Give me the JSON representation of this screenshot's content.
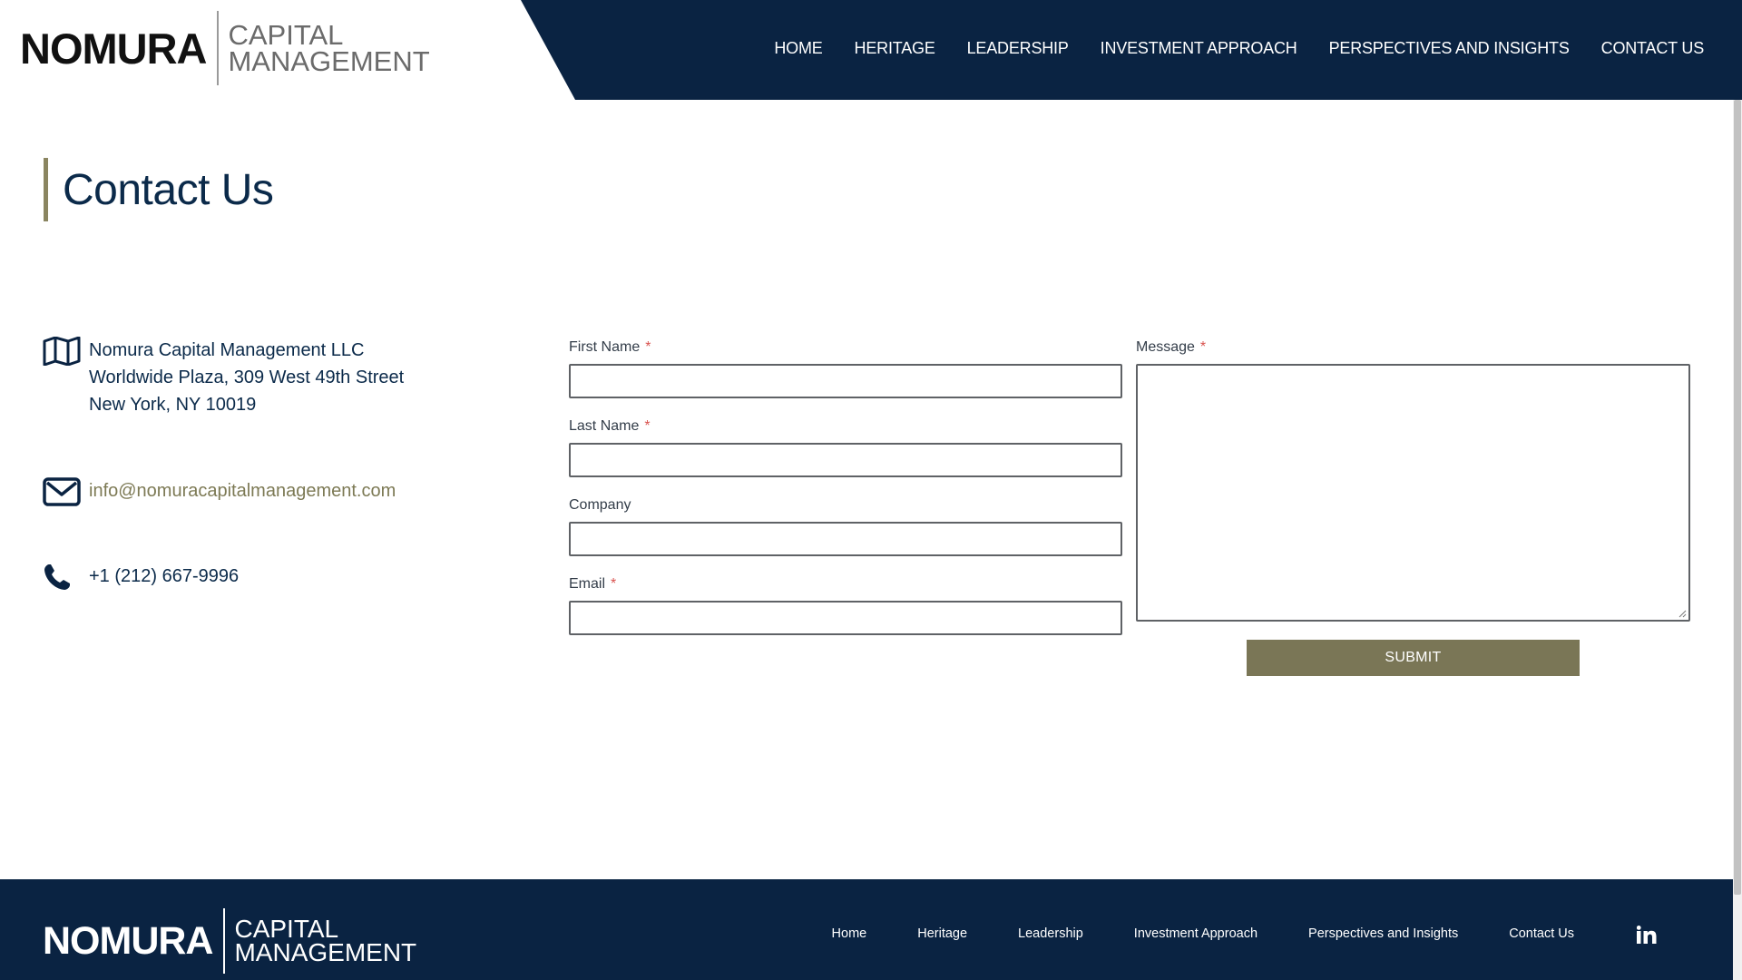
{
  "brand": {
    "wordmark": "NOMURA",
    "sub_line1": "CAPITAL",
    "sub_line2": "MANAGEMENT"
  },
  "nav": {
    "items": [
      "HOME",
      "HERITAGE",
      "LEADERSHIP",
      "INVESTMENT APPROACH",
      "PERSPECTIVES AND INSIGHTS",
      "CONTACT US"
    ]
  },
  "page": {
    "title": "Contact Us"
  },
  "contact": {
    "address_line1": "Nomura Capital Management LLC",
    "address_line2": "Worldwide Plaza, 309 West 49th Street",
    "address_line3": "New York, NY 10019",
    "email": "info@nomuracapitalmanagement.com",
    "phone": "+1 (212) 667-9996",
    "icons": [
      "map-icon",
      "envelope-icon",
      "phone-icon"
    ]
  },
  "form": {
    "first_name_label": "First Name",
    "last_name_label": "Last Name",
    "company_label": "Company",
    "email_label": "Email",
    "message_label": "Message",
    "required_mark": "*",
    "submit_label": "SUBMIT",
    "first_name_value": "",
    "last_name_value": "",
    "company_value": "",
    "email_value": "",
    "message_value": ""
  },
  "footer": {
    "links": [
      "Home",
      "Heritage",
      "Leadership",
      "Investment Approach",
      "Perspectives and Insights",
      "Contact Us"
    ],
    "social_icon": "linkedin-icon"
  },
  "colors": {
    "navy": "#0a2342",
    "olive": "#7a7656",
    "title_text": "#0b2a4a",
    "required": "#d9534f"
  }
}
